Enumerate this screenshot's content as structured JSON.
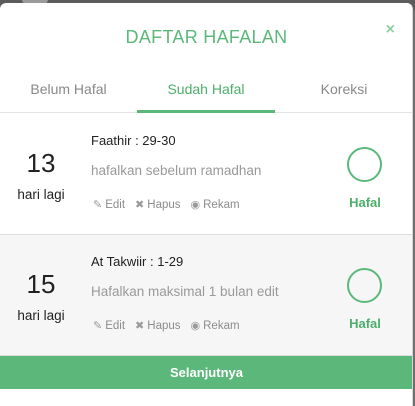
{
  "modal": {
    "title": "DAFTAR HAFALAN",
    "close_icon": "close-icon",
    "close_glyph": "×"
  },
  "tabs": [
    {
      "label": "Belum Hafal",
      "active": false
    },
    {
      "label": "Sudah Hafal",
      "active": true
    },
    {
      "label": "Koreksi",
      "active": false
    }
  ],
  "items": [
    {
      "days": "13",
      "days_label": "hari lagi",
      "surah": "Faathir : 29-30",
      "note": "hafalkan sebelum ramadhan",
      "actions": {
        "edit": "Edit",
        "delete": "Hapus",
        "record": "Rekam"
      },
      "status": "Hafal"
    },
    {
      "days": "15",
      "days_label": "hari lagi",
      "surah": "At Takwiir : 1-29",
      "note": "Hafalkan maksimal 1 bulan edit",
      "actions": {
        "edit": "Edit",
        "delete": "Hapus",
        "record": "Rekam"
      },
      "status": "Hafal"
    }
  ],
  "footer": {
    "next_label": "Selanjutnya"
  },
  "colors": {
    "accent": "#5cb87a",
    "muted_text": "#999999"
  },
  "icons": {
    "edit": "edit-icon",
    "delete": "x-icon",
    "record": "record-icon"
  }
}
